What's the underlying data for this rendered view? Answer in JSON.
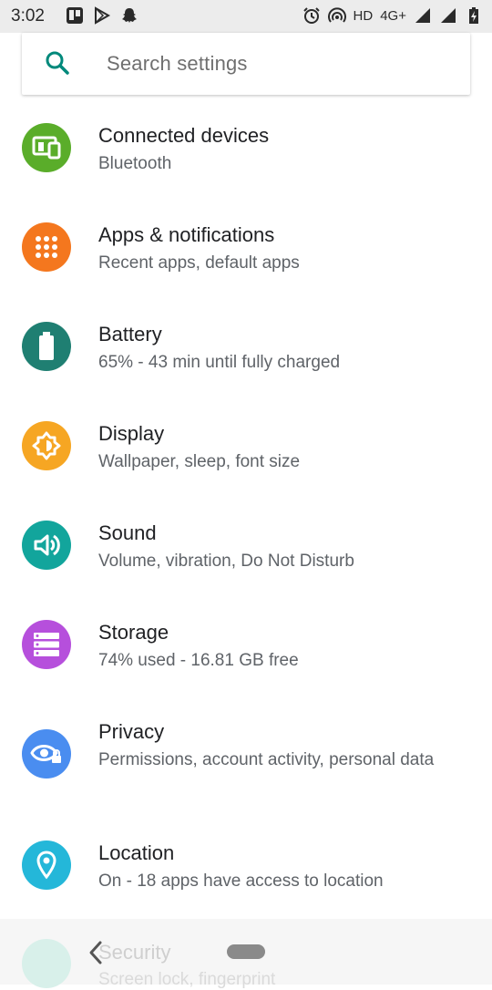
{
  "status_bar": {
    "time": "3:02",
    "hd": "HD",
    "network": "4G+"
  },
  "search": {
    "placeholder": "Search settings",
    "accent": "#00897b"
  },
  "items": [
    {
      "title": "Connected devices",
      "subtitle": "Bluetooth",
      "icon": "devices-icon",
      "color": "#5aad2a"
    },
    {
      "title": "Apps & notifications",
      "subtitle": "Recent apps, default apps",
      "icon": "apps-grid-icon",
      "color": "#f4771e"
    },
    {
      "title": "Battery",
      "subtitle": "65% - 43 min until fully charged",
      "icon": "battery-icon",
      "color": "#1f7f72"
    },
    {
      "title": "Display",
      "subtitle": "Wallpaper, sleep, font size",
      "icon": "brightness-icon",
      "color": "#f6a623"
    },
    {
      "title": "Sound",
      "subtitle": "Volume, vibration, Do Not Disturb",
      "icon": "volume-icon",
      "color": "#12a59c"
    },
    {
      "title": "Storage",
      "subtitle": "74% used - 16.81 GB free",
      "icon": "storage-icon",
      "color": "#b64fdc"
    },
    {
      "title": "Privacy",
      "subtitle": "Permissions, account activity, personal data",
      "icon": "privacy-eye-icon",
      "color": "#4a8df0"
    },
    {
      "title": "Location",
      "subtitle": "On - 18 apps have access to location",
      "icon": "location-pin-icon",
      "color": "#24b7d9"
    }
  ],
  "partial_item": {
    "title": "Security",
    "subtitle": "Screen lock, fingerprint"
  }
}
